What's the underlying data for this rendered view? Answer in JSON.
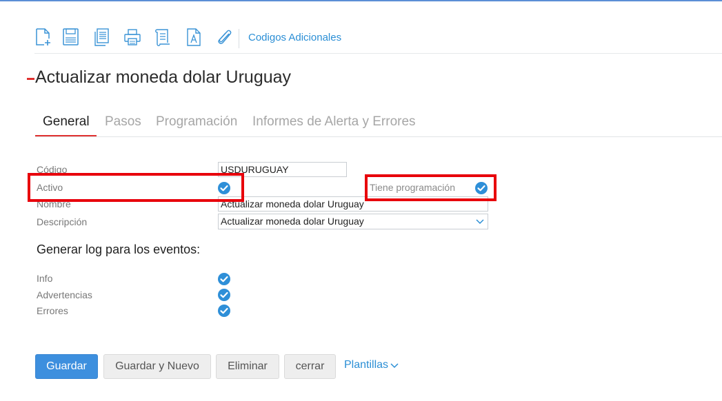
{
  "toolbar": {
    "icons": [
      "new-document-icon",
      "save-icon",
      "copy-icon",
      "print-icon",
      "scroll-icon",
      "font-document-icon",
      "paperclip-icon"
    ],
    "link_label": "Codigos Adicionales"
  },
  "page": {
    "title": "Actualizar moneda dolar Uruguay"
  },
  "tabs": [
    {
      "label": "General",
      "active": true
    },
    {
      "label": "Pasos",
      "active": false
    },
    {
      "label": "Programación",
      "active": false
    },
    {
      "label": "Informes de Alerta y Errores",
      "active": false
    }
  ],
  "form": {
    "codigo_label": "Código",
    "codigo_value": "USDURUGUAY",
    "activo_label": "Activo",
    "activo_checked": true,
    "tiene_programacion_label": "Tiene programación",
    "tiene_programacion_checked": true,
    "nombre_label": "Nombre",
    "nombre_value": "Actualizar moneda dolar Uruguay",
    "descripcion_label": "Descripción",
    "descripcion_value": "Actualizar moneda dolar Uruguay"
  },
  "log_section": {
    "title": "Generar log para los eventos:",
    "items": [
      {
        "label": "Info",
        "checked": true
      },
      {
        "label": "Advertencias",
        "checked": true
      },
      {
        "label": "Errores",
        "checked": true
      }
    ]
  },
  "buttons": {
    "save": "Guardar",
    "save_new": "Guardar y Nuevo",
    "delete": "Eliminar",
    "close": "cerrar",
    "templates": "Plantillas"
  },
  "colors": {
    "accent": "#2a8ed5",
    "primary_button": "#3d8fde",
    "tab_underline": "#e0302f",
    "highlight_box": "#e8000b",
    "check": "#2e8fd8"
  }
}
